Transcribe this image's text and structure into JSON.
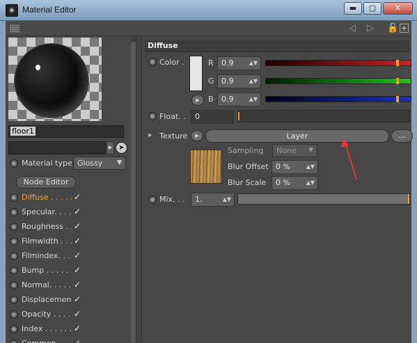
{
  "window": {
    "title": "Material Editor",
    "buttons": {
      "minimize": "▬",
      "maximize": "▢",
      "close": "✕"
    }
  },
  "toolbar": {
    "icons": [
      "grip-icon",
      "arrow-left-icon",
      "arrow-right-icon",
      "lock-icon",
      "new-window-icon"
    ]
  },
  "left": {
    "material_name": "floor1",
    "material_type_label": "Material type",
    "material_type_value": "Glossy",
    "node_editor_label": "Node Editor",
    "channels": [
      {
        "label": "Diffuse . . . . . .",
        "checked": true,
        "active": true
      },
      {
        "label": "Specular. . . . . .",
        "checked": true,
        "active": false
      },
      {
        "label": "Roughness . . . . .",
        "checked": true,
        "active": false
      },
      {
        "label": "Filmwidth . . . . .",
        "checked": true,
        "active": false
      },
      {
        "label": "Filmindex. . . . . .",
        "checked": true,
        "active": false
      },
      {
        "label": "Bump . . . . . . . .",
        "checked": true,
        "active": false
      },
      {
        "label": "Normal. . . . . . . .",
        "checked": true,
        "active": false
      },
      {
        "label": "Displacement",
        "checked": true,
        "active": false
      },
      {
        "label": "Opacity . . . . . .",
        "checked": true,
        "active": false
      },
      {
        "label": "Index . . . . . . . .",
        "checked": true,
        "active": false
      },
      {
        "label": "Common . . . . . .",
        "checked": true,
        "active": false
      }
    ],
    "check_glyph": "✓"
  },
  "right": {
    "section_title": "Diffuse",
    "color": {
      "label": "Color .",
      "r_label": "R",
      "r_value": "0.9",
      "r_fraction": 0.9,
      "g_label": "G",
      "g_value": "0.9",
      "g_fraction": 0.9,
      "b_label": "B",
      "b_value": "0.9",
      "b_fraction": 0.9
    },
    "float": {
      "label": "Float. .",
      "value": "0",
      "fraction": 0
    },
    "texture": {
      "label": "Texture",
      "button_label": "Layer",
      "more_label": "..."
    },
    "sampling": {
      "label": "Sampling",
      "value": "None"
    },
    "blur_offset": {
      "label": "Blur Offset",
      "value": "0 %"
    },
    "blur_scale": {
      "label": "Blur Scale",
      "value": "0 %"
    },
    "mix": {
      "label": "Mix. . .",
      "value": "1.",
      "fraction": 1.0
    }
  },
  "colors": {
    "accent": "#f0a020",
    "red": "#c62828",
    "green": "#2e9e2e",
    "blue": "#1a2fa8",
    "annotation": "#e53935"
  }
}
